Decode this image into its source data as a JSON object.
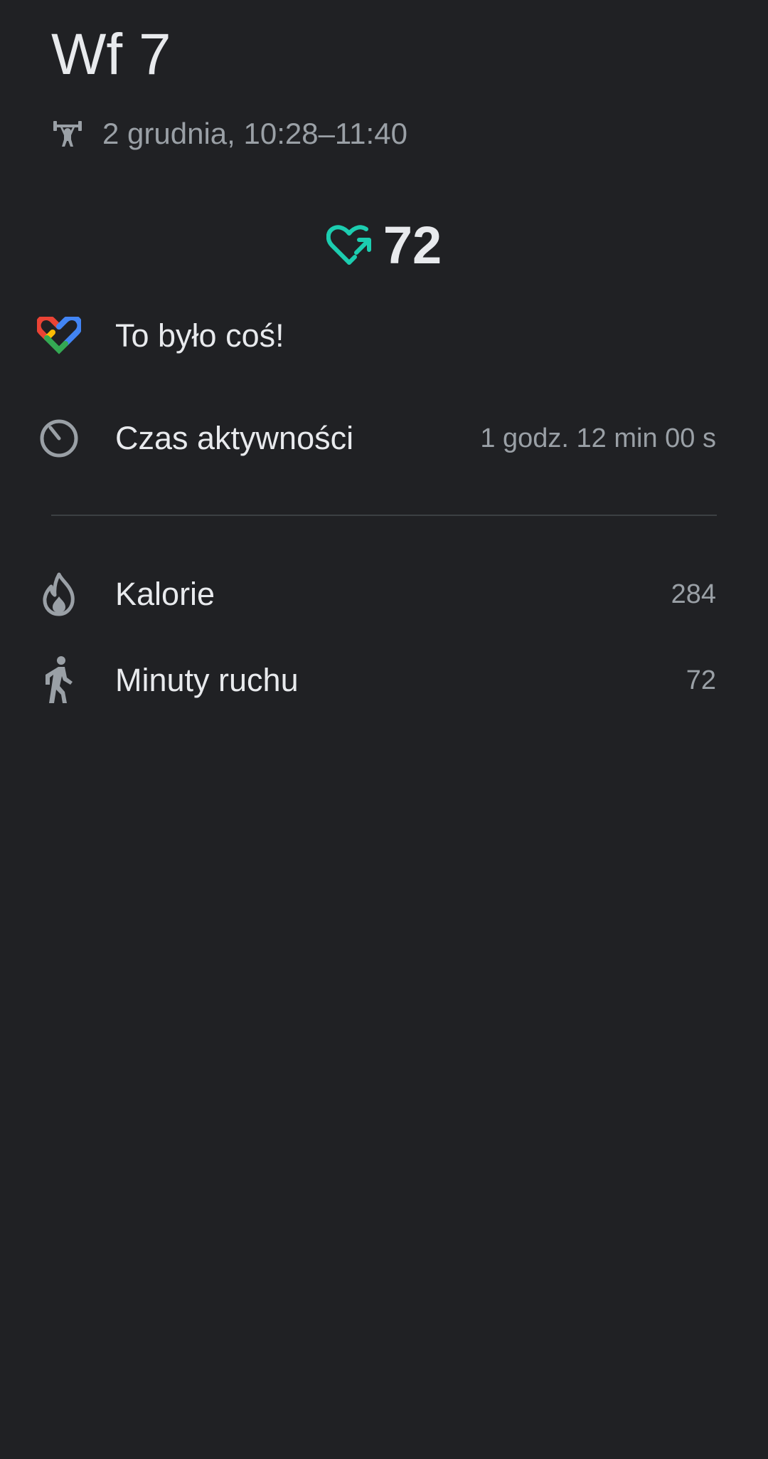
{
  "header": {
    "title": "Wf 7",
    "activity_icon": "weightlifting-icon",
    "date_range": "2 grudnia, 10:28–11:40"
  },
  "heart_points": {
    "icon": "heart-points-icon",
    "value": "72",
    "color": "#1ccdb0"
  },
  "summary": {
    "icon": "google-fit-logo",
    "message": "To było coś!"
  },
  "active_time": {
    "icon": "timer-icon",
    "label": "Czas aktywności",
    "value": "1 godz. 12 min 00 s"
  },
  "metrics": [
    {
      "icon": "flame-icon",
      "label": "Kalorie",
      "value": "284"
    },
    {
      "icon": "walking-icon",
      "label": "Minuty ruchu",
      "value": "72"
    }
  ],
  "colors": {
    "background": "#202124",
    "primary_text": "#e8eaed",
    "secondary_text": "#9aa0a6",
    "icon_gray": "#9aa0a6",
    "accent": "#1ccdb0"
  }
}
